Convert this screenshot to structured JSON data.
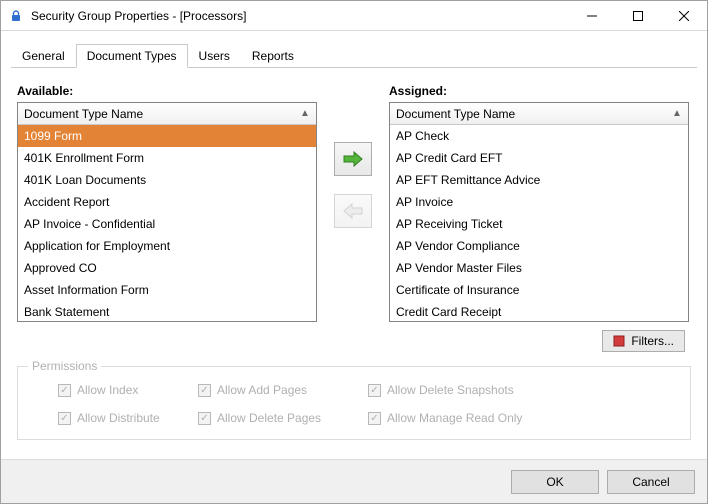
{
  "window": {
    "title": "Security Group Properties - [Processors]"
  },
  "tabs": [
    {
      "label": "General",
      "active": false
    },
    {
      "label": "Document Types",
      "active": true
    },
    {
      "label": "Users",
      "active": false
    },
    {
      "label": "Reports",
      "active": false
    }
  ],
  "available": {
    "label": "Available:",
    "column_header": "Document Type Name",
    "items": [
      "1099 Form",
      "401K Enrollment Form",
      "401K Loan Documents",
      "Accident Report",
      "AP Invoice - Confidential",
      "Application for Employment",
      "Approved CO",
      "Asset Information Form",
      "Bank Statement"
    ],
    "selected_index": 0
  },
  "assigned": {
    "label": "Assigned:",
    "column_header": "Document Type Name",
    "items": [
      "AP Check",
      "AP Credit Card EFT",
      "AP EFT Remittance Advice",
      "AP Invoice",
      "AP Receiving Ticket",
      "AP Vendor Compliance",
      "AP Vendor Master Files",
      "Certificate of Insurance",
      "Credit Card Receipt"
    ],
    "selected_index": -1
  },
  "buttons": {
    "filters": "Filters...",
    "ok": "OK",
    "cancel": "Cancel"
  },
  "permissions": {
    "legend": "Permissions",
    "items": [
      {
        "label": "Allow Index",
        "checked": true
      },
      {
        "label": "Allow Add Pages",
        "checked": true
      },
      {
        "label": "Allow Delete Snapshots",
        "checked": true
      },
      {
        "label": "Allow Distribute",
        "checked": true
      },
      {
        "label": "Allow Delete Pages",
        "checked": true
      },
      {
        "label": "Allow Manage Read Only",
        "checked": true
      }
    ]
  }
}
